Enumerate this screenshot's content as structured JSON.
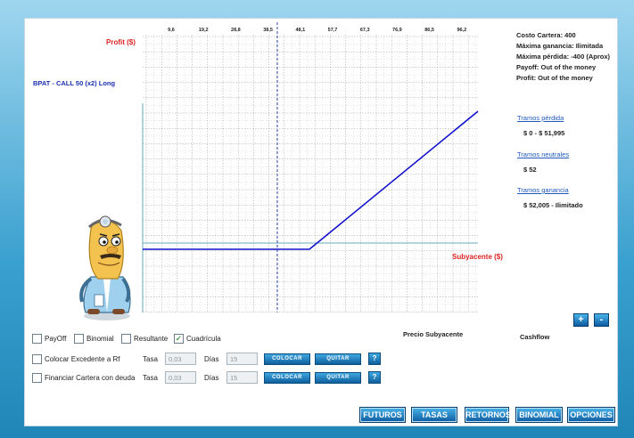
{
  "chart_data": {
    "type": "line",
    "title": "BPAT - CALL 50 (x2) Long",
    "ylabel": "Profit ($)",
    "xlabel": "Subyacente ($)",
    "x_ticks": [
      "9,6",
      "19,2",
      "28,8",
      "38,5",
      "48,1",
      "57,7",
      "67,3",
      "76,9",
      "86,5",
      "96,2"
    ],
    "series": [
      {
        "x": [
          0,
          51.995,
          96.2
        ],
        "y": [
          -400,
          -400,
          3580
        ]
      }
    ],
    "colors": {
      "line": "#1111cc",
      "grid": "#222222",
      "axis": "#66aabb",
      "spot_line": "#3344aa"
    },
    "grid": true
  },
  "info": {
    "costo": "Costo Cartera: 400",
    "max_gain": "Máxima ganancia: Ilimitada",
    "max_loss": "Máxima pérdida: -400 (Aprox)",
    "payoff": "Payoff: Out of the money",
    "profit": "Profit: Out of the money"
  },
  "tramos": {
    "perdida_label": "Tramos pérdida",
    "perdida_value": "$ 0 - $ 51,995",
    "neutrales_label": "Tramos neutrales",
    "neutrales_value": "$ 52",
    "ganancia_label": "Tramos ganancia",
    "ganancia_value": "$ 52,005 - Ilimitado"
  },
  "labels": {
    "precio_subyacente": "Precio Subyacente",
    "cashflow": "Cashflow"
  },
  "checks": {
    "payoff": "PayOff",
    "binomial": "Binomial",
    "resultante": "Resultante",
    "cuadricula": "Cuadrícula",
    "check_mark": "✓"
  },
  "rows": {
    "excedente": "Colocar Excedente a Rf",
    "financiar": "Financiar Cartera con deuda",
    "tasa": "Tasa",
    "dias": "Días",
    "tasa_value": "0,03",
    "dias_value": "15",
    "colocar": "COLOCAR",
    "quitar": "QUITAR",
    "help": "?"
  },
  "zoom": {
    "plus": "+",
    "minus": "-"
  },
  "nav": {
    "futuros": "FUTUROS",
    "tasas": "TASAS",
    "retornos": "RETORNOS",
    "binomial": "BINOMIAL",
    "opciones": "OPCIONES"
  }
}
